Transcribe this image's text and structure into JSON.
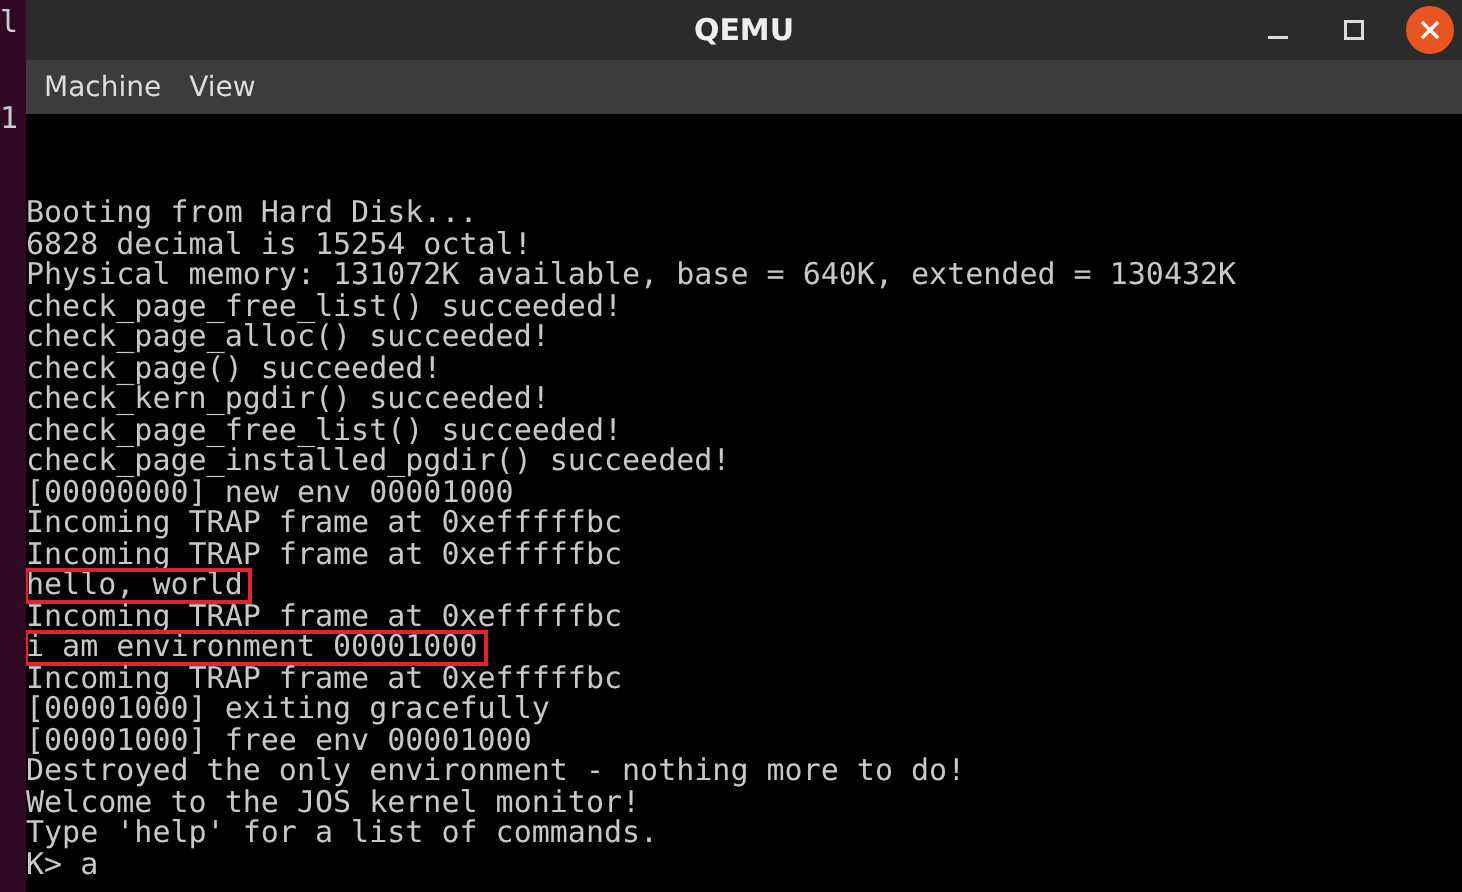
{
  "backdrop": {
    "lines": [
      "l",
      "1"
    ]
  },
  "window": {
    "title": "QEMU"
  },
  "menu": [
    {
      "label": "Machine"
    },
    {
      "label": "View"
    }
  ],
  "console": {
    "lines": [
      {
        "text": "Booting from Hard Disk...",
        "highlighted": false
      },
      {
        "text": "6828 decimal is 15254 octal!",
        "highlighted": false
      },
      {
        "text": "Physical memory: 131072K available, base = 640K, extended = 130432K",
        "highlighted": false
      },
      {
        "text": "check_page_free_list() succeeded!",
        "highlighted": false
      },
      {
        "text": "check_page_alloc() succeeded!",
        "highlighted": false
      },
      {
        "text": "check_page() succeeded!",
        "highlighted": false
      },
      {
        "text": "check_kern_pgdir() succeeded!",
        "highlighted": false
      },
      {
        "text": "check_page_free_list() succeeded!",
        "highlighted": false
      },
      {
        "text": "check_page_installed_pgdir() succeeded!",
        "highlighted": false
      },
      {
        "text": "[00000000] new env 00001000",
        "highlighted": false
      },
      {
        "text": "Incoming TRAP frame at 0xefffffbc",
        "highlighted": false
      },
      {
        "text": "Incoming TRAP frame at 0xefffffbc",
        "highlighted": false
      },
      {
        "text": "hello, world",
        "highlighted": true
      },
      {
        "text": "Incoming TRAP frame at 0xefffffbc",
        "highlighted": false
      },
      {
        "text": "i am environment 00001000",
        "highlighted": true
      },
      {
        "text": "Incoming TRAP frame at 0xefffffbc",
        "highlighted": false
      },
      {
        "text": "[00001000] exiting gracefully",
        "highlighted": false
      },
      {
        "text": "[00001000] free env 00001000",
        "highlighted": false
      },
      {
        "text": "Destroyed the only environment - nothing more to do!",
        "highlighted": false
      },
      {
        "text": "Welcome to the JOS kernel monitor!",
        "highlighted": false
      },
      {
        "text": "Type 'help' for a list of commands.",
        "highlighted": false
      },
      {
        "text": "K> a",
        "highlighted": false
      }
    ]
  }
}
